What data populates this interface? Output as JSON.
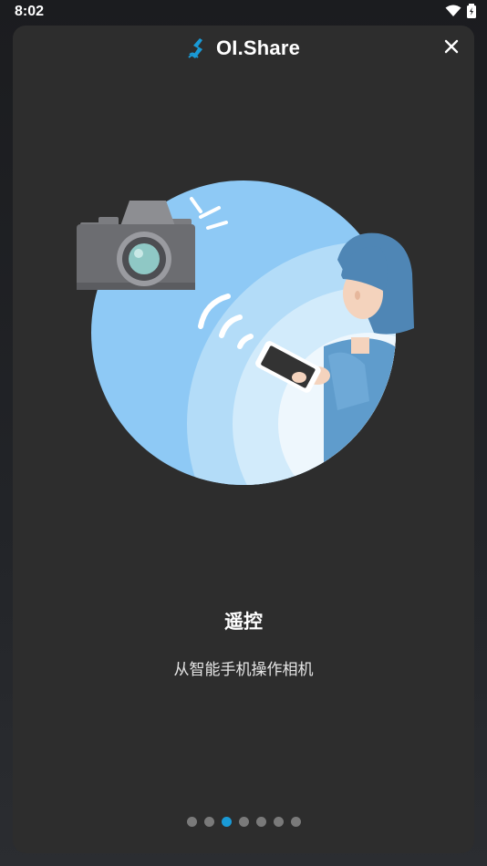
{
  "status_bar": {
    "time": "8:02"
  },
  "header": {
    "app_name": "OI.Share",
    "logo_icon": "oishare-logo-icon",
    "close_icon": "close-icon"
  },
  "slide": {
    "title": "遥控",
    "subtitle": "从智能手机操作相机",
    "illustration": "camera-remote-control-illustration"
  },
  "pager": {
    "total": 7,
    "active_index": 2
  },
  "colors": {
    "background": "#2d2d2d",
    "accent": "#1a9ad6",
    "circle": "#8ec9f5"
  }
}
